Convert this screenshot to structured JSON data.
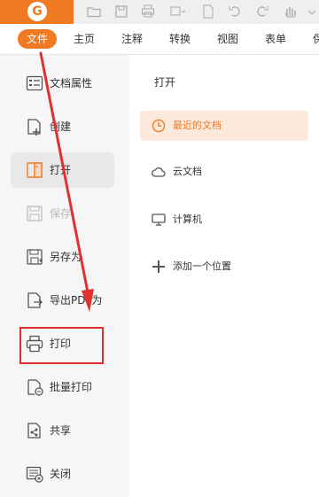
{
  "app": {
    "logo_glyph": "G",
    "accent": "#f07a22"
  },
  "menu": {
    "items": [
      {
        "label": "文件",
        "active": true
      },
      {
        "label": "主页"
      },
      {
        "label": "注释"
      },
      {
        "label": "转换"
      },
      {
        "label": "视图"
      },
      {
        "label": "表单"
      },
      {
        "label": "保"
      }
    ]
  },
  "file_menu": {
    "items": [
      {
        "label": "文档属性",
        "icon": "document-properties-icon"
      },
      {
        "label": "创建",
        "icon": "create-icon"
      },
      {
        "label": "打开",
        "icon": "open-icon",
        "selected": true
      },
      {
        "label": "保存",
        "icon": "save-icon",
        "disabled": true
      },
      {
        "label": "另存为",
        "icon": "save-as-icon"
      },
      {
        "label": "导出PDF为",
        "icon": "export-pdf-icon"
      },
      {
        "label": "打印",
        "icon": "printer-icon",
        "highlighted": true
      },
      {
        "label": "批量打印",
        "icon": "batch-print-icon"
      },
      {
        "label": "共享",
        "icon": "share-icon"
      },
      {
        "label": "关闭",
        "icon": "close-document-icon"
      }
    ]
  },
  "open_panel": {
    "title": "打开",
    "items": [
      {
        "label": "最近的文档",
        "icon": "clock-icon",
        "selected": true
      },
      {
        "label": "云文档",
        "icon": "cloud-icon"
      },
      {
        "label": "计算机",
        "icon": "computer-icon"
      },
      {
        "label": "添加一个位置",
        "icon": "plus-icon"
      }
    ]
  },
  "annotation": {
    "highlight_color": "#e03030",
    "arrow_color": "#e03030"
  }
}
